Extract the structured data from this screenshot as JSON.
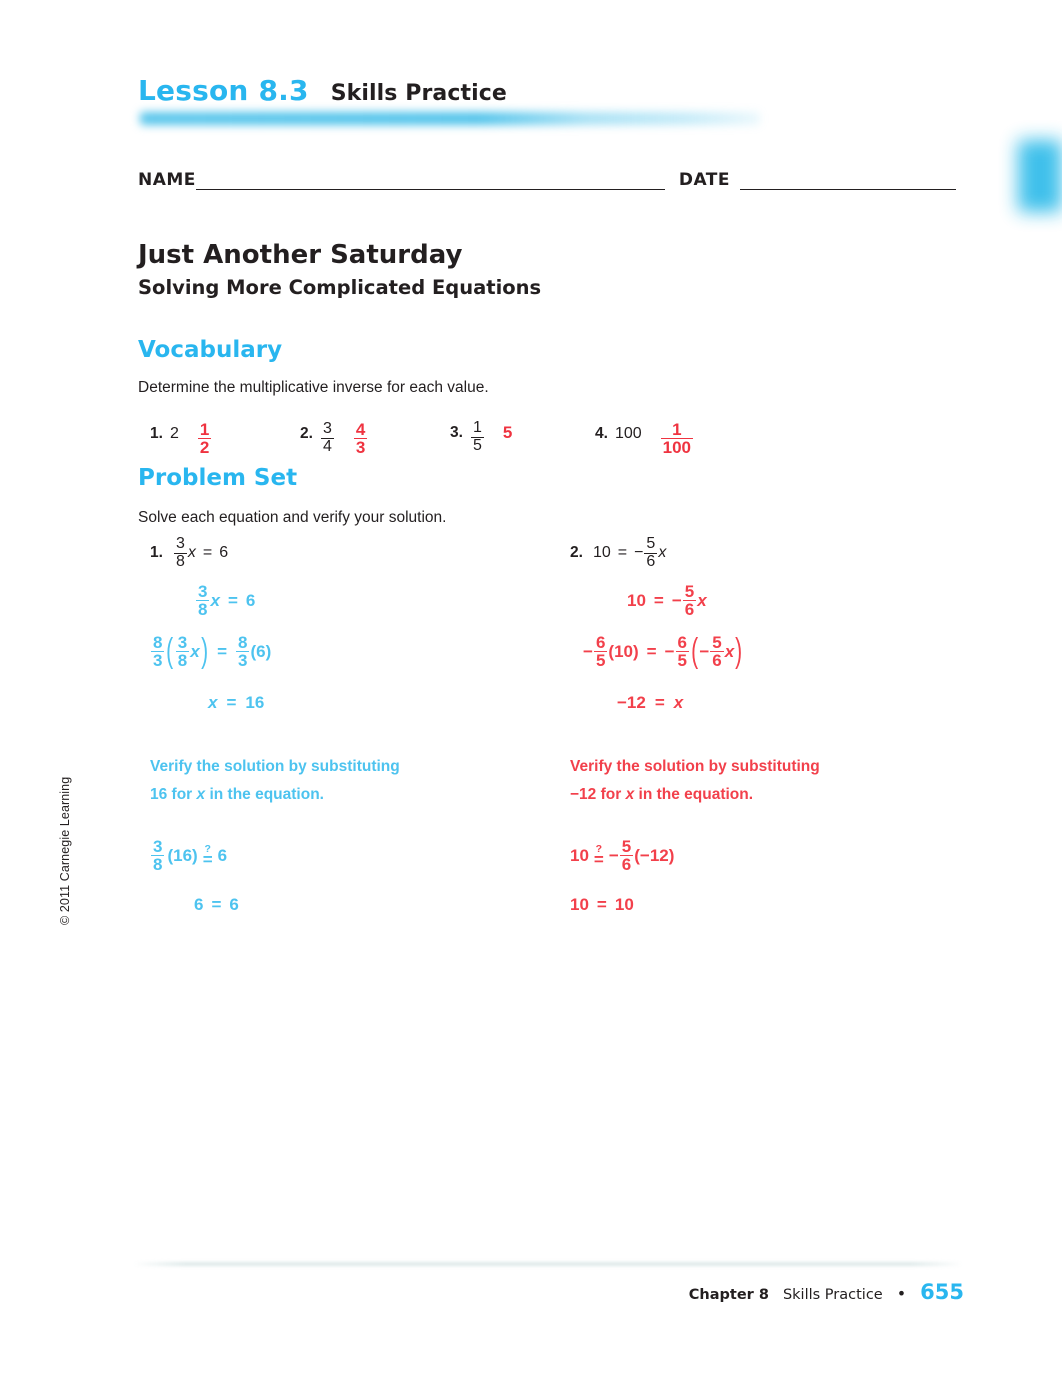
{
  "header": {
    "lesson": "Lesson 8.3",
    "practice": "Skills Practice",
    "blurred_subtitle": ""
  },
  "form": {
    "name_label": "NAME",
    "date_label": "DATE"
  },
  "titles": {
    "title": "Just Another Saturday",
    "subtitle": "Solving More Complicated Equations"
  },
  "vocabulary": {
    "heading": "Vocabulary",
    "instruction": "Determine the multiplicative inverse for each value.",
    "items": [
      {
        "number": "1.",
        "value": "2",
        "answer_num": "1",
        "answer_den": "2",
        "answer_plain": ""
      },
      {
        "number": "2.",
        "value_num": "3",
        "value_den": "4",
        "answer_num": "4",
        "answer_den": "3",
        "answer_plain": ""
      },
      {
        "number": "3.",
        "value_num": "1",
        "value_den": "5",
        "answer_plain": "5"
      },
      {
        "number": "4.",
        "value": "100",
        "answer_num": "1",
        "answer_den": "100",
        "answer_plain": ""
      }
    ]
  },
  "problem_set": {
    "heading": "Problem Set",
    "instruction": "Solve each equation and verify your solution.",
    "problems": [
      {
        "number": "1.",
        "color": "#4dc3ef",
        "prompt": {
          "frac_num": "3",
          "frac_den": "8",
          "var": "x",
          "rel": "=",
          "rhs": "6"
        },
        "steps": [
          {
            "id": "s1",
            "text": "3/8 x = 6"
          },
          {
            "id": "s2",
            "text": "8/3 ( 3/8 x ) = 8/3 (6)"
          },
          {
            "id": "s3",
            "text": "x = 16"
          }
        ],
        "verify_line1": "Verify the solution by substituting",
        "verify_line2_prefix": "16 for ",
        "verify_line2_var": "x",
        "verify_line2_suffix": " in the equation.",
        "check": [
          {
            "id": "c1",
            "text": "3/8 (16) =? 6"
          },
          {
            "id": "c2",
            "text": "6 = 6"
          }
        ],
        "values": {
          "a_num": "3",
          "a_den": "8",
          "m_num": "8",
          "m_den": "3",
          "rhs": "6",
          "solution": "16",
          "check_sub": "(16)",
          "check_rhs": "6",
          "check_final_left": "6",
          "check_final_right": "6",
          "x": "x",
          "eq": "=",
          "q": "?"
        }
      },
      {
        "number": "2.",
        "color": "#f2404b",
        "prompt": {
          "lhs": "10",
          "rel": "=",
          "sign": "−",
          "frac_num": "5",
          "frac_den": "6",
          "var": "x"
        },
        "steps": [
          {
            "id": "s1",
            "text": "10 = -5/6 x"
          },
          {
            "id": "s2",
            "text": "-6/5 (10) = -6/5 ( -5/6 x )"
          },
          {
            "id": "s3",
            "text": "-12 = x"
          }
        ],
        "verify_line1": "Verify the solution by substituting",
        "verify_line2_prefix": "−12 for ",
        "verify_line2_var": "x",
        "verify_line2_suffix": " in the equation.",
        "check": [
          {
            "id": "c1",
            "text": "10 =? -5/6 (-12)"
          },
          {
            "id": "c2",
            "text": "10 = 10"
          }
        ],
        "values": {
          "lhs": "10",
          "a_num": "5",
          "a_den": "6",
          "m_num": "6",
          "m_den": "5",
          "neg": "−",
          "solution": "−12",
          "check_sub": "(−12)",
          "check_final_left": "10",
          "check_final_right": "10",
          "x": "x",
          "eq": "=",
          "q": "?",
          "ten_paren": "(10)"
        }
      }
    ]
  },
  "copyright": "© 2011 Carnegie Learning",
  "footer": {
    "chapter": "Chapter 8",
    "section": "Skills Practice",
    "separator": "•",
    "page": "655"
  },
  "colors": {
    "brand_blue": "#29b6ef",
    "step_blue": "#4dc3ef",
    "answer_red": "#ef3340",
    "step_red": "#f2404b",
    "text": "#231f20"
  }
}
